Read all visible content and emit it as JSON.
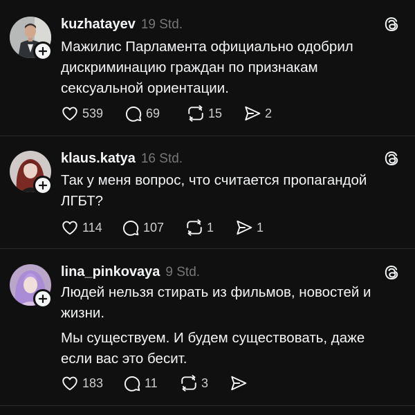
{
  "posts": [
    {
      "username": "kuzhatayev",
      "time": "19 Std.",
      "paragraphs": [
        "Мажилис Парламента официально одобрил дискриминацию граждан по признакам сексуальной ориентации."
      ],
      "likes": "539",
      "comments": "69",
      "reposts": "15",
      "shares": "2",
      "avatar_icon": "avatar-man-in-suit"
    },
    {
      "username": "klaus.katya",
      "time": "16 Std.",
      "paragraphs": [
        "Так у меня вопрос, что считается пропагандой ЛГБТ?"
      ],
      "likes": "114",
      "comments": "107",
      "reposts": "1",
      "shares": "1",
      "avatar_icon": "avatar-red-haired-woman"
    },
    {
      "username": "lina_pinkovaya",
      "time": "9 Std.",
      "paragraphs": [
        "Людей нельзя стирать из фильмов, новостей и жизни.",
        "Мы существуем. И будем существовать, даже если вас это бесит."
      ],
      "likes": "183",
      "comments": "11",
      "reposts": "3",
      "shares": "",
      "avatar_icon": "avatar-purple-haired-woman"
    }
  ],
  "icons": {
    "like": "heart-icon",
    "comment": "comment-bubble-icon",
    "repost": "repost-icon",
    "share": "send-icon",
    "follow": "plus-icon",
    "brand": "threads-logo-icon"
  },
  "colors": {
    "background": "#101010",
    "text": "#f3f5f7",
    "muted": "#777777",
    "divider": "#2b2b2b"
  }
}
